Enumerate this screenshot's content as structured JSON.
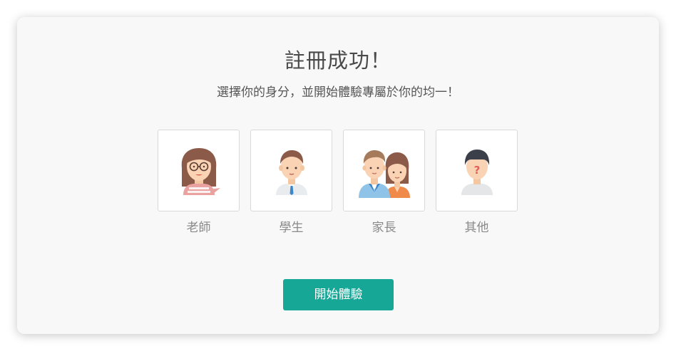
{
  "dialog": {
    "title": "註冊成功！",
    "subtitle": "選擇你的身分，並開始體驗專屬於你的均一！"
  },
  "roles": [
    {
      "label": "老師",
      "icon": "teacher-avatar-icon"
    },
    {
      "label": "學生",
      "icon": "student-avatar-icon"
    },
    {
      "label": "家長",
      "icon": "parent-avatar-icon"
    },
    {
      "label": "其他",
      "icon": "other-avatar-icon"
    }
  ],
  "actions": {
    "start_label": "開始體驗"
  },
  "colors": {
    "accent": "#17a797",
    "card_background": "#f8f8f8",
    "title_text": "#4a4a4a",
    "label_text": "#8a8a8a"
  }
}
